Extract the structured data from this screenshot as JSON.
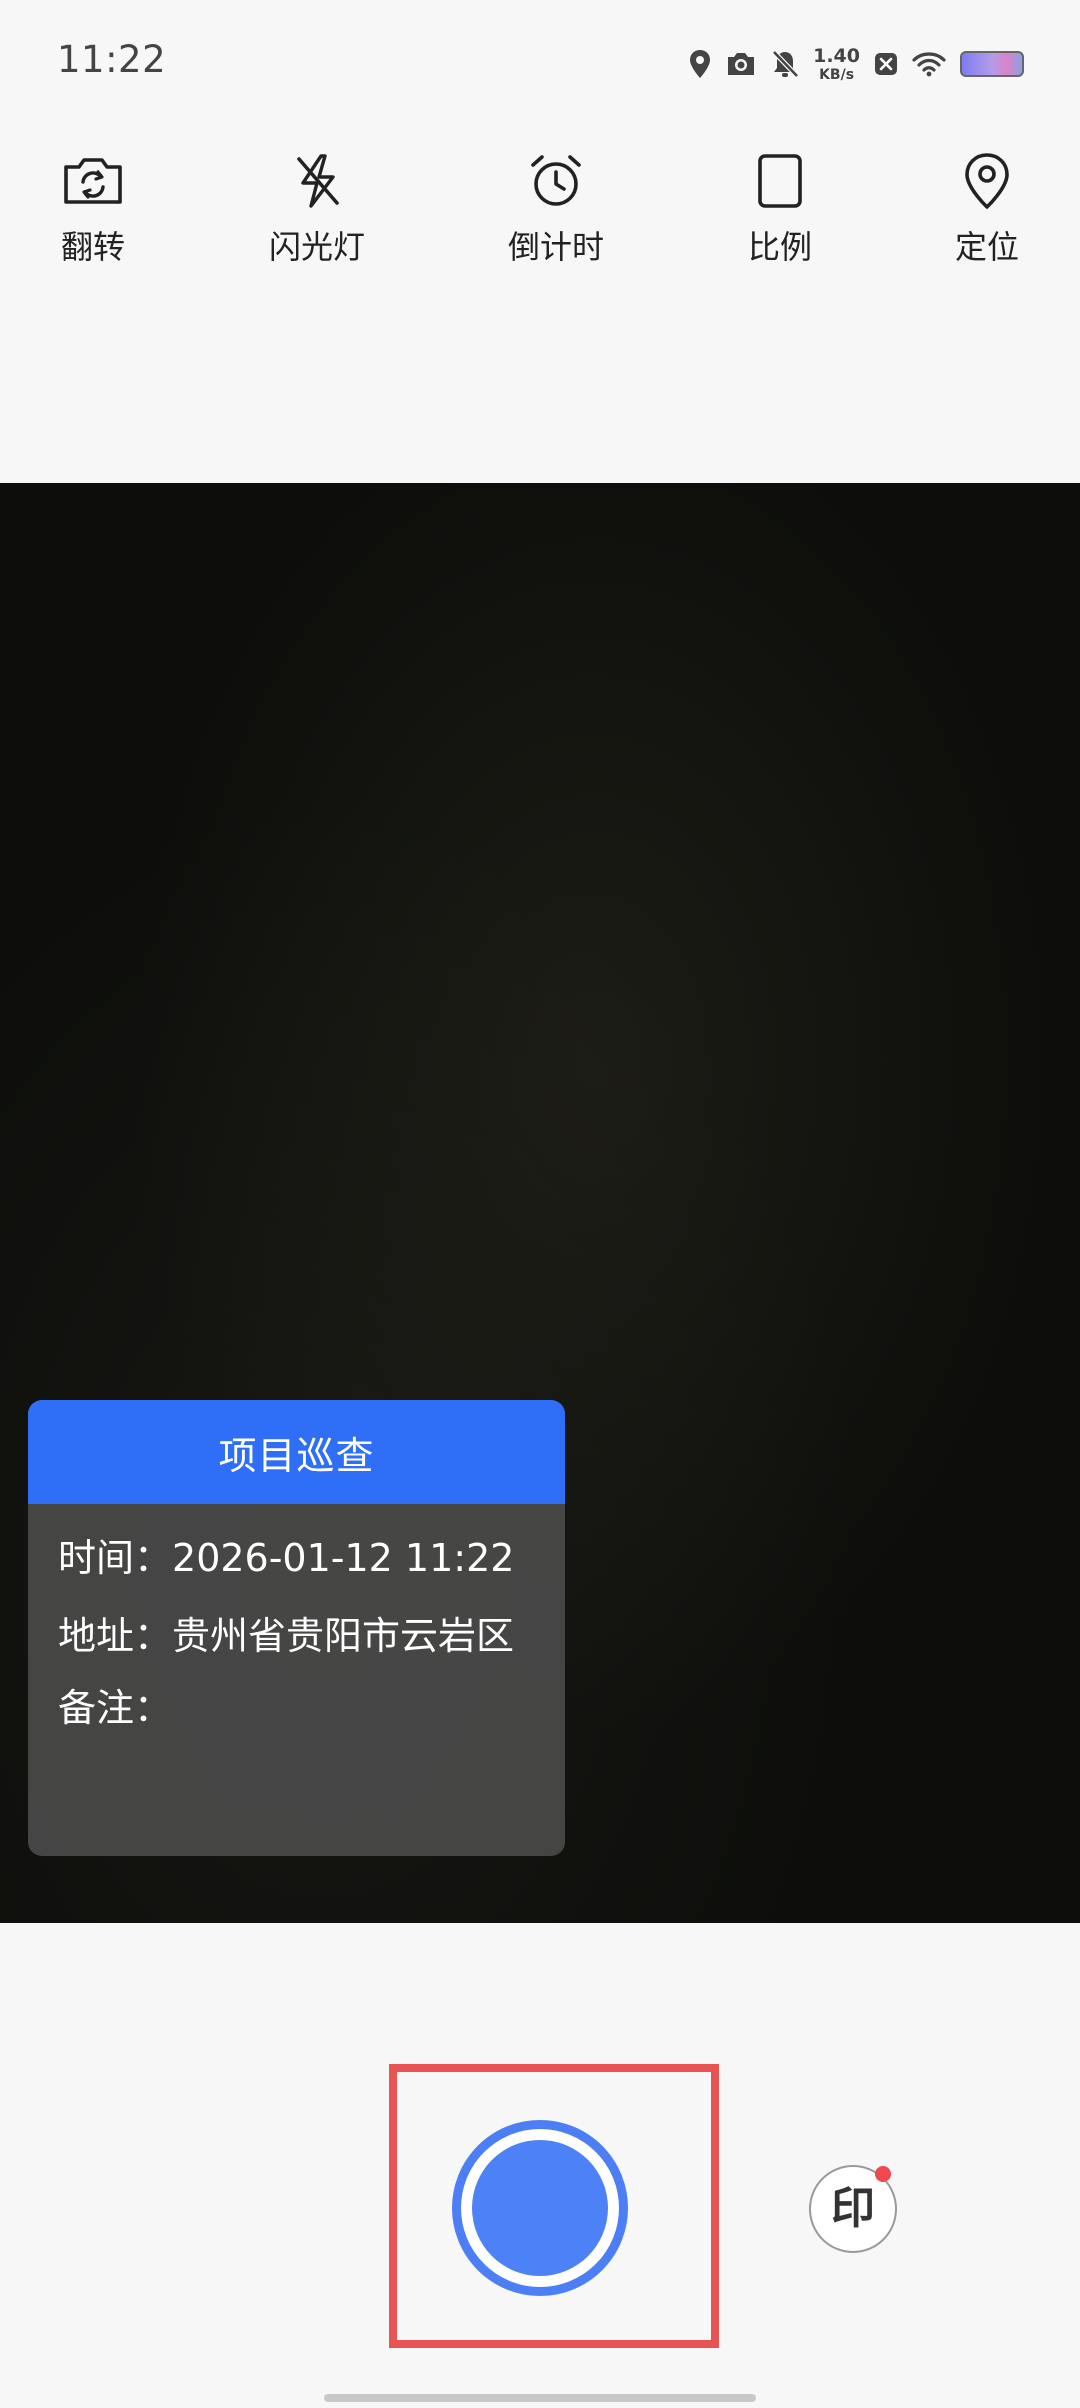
{
  "status_bar": {
    "time": "11:22",
    "net_speed_value": "1.40",
    "net_speed_unit": "KB/s",
    "icons": [
      "location-icon",
      "camera-icon",
      "mute-bell-icon",
      "net-speed",
      "close-box-icon",
      "wifi-icon",
      "battery-icon"
    ]
  },
  "toolbar": {
    "items": [
      {
        "label": "翻转",
        "icon": "flip-camera-icon"
      },
      {
        "label": "闪光灯",
        "icon": "flash-off-icon"
      },
      {
        "label": "倒计时",
        "icon": "alarm-clock-icon"
      },
      {
        "label": "比例",
        "icon": "aspect-ratio-icon"
      },
      {
        "label": "定位",
        "icon": "map-pin-icon"
      }
    ]
  },
  "watermark": {
    "title": "项目巡查",
    "time_label": "时间：",
    "time_value": "2026-01-12 11:22",
    "address_label": "地址：",
    "address_value": "贵州省贵阳市云岩区",
    "note_label": "备注：",
    "note_value": "",
    "colors": {
      "header": "#2f6ef6"
    }
  },
  "controls": {
    "stamp_label": "印",
    "shutter_color": "#4d82f7",
    "highlight_color": "#e85454"
  }
}
